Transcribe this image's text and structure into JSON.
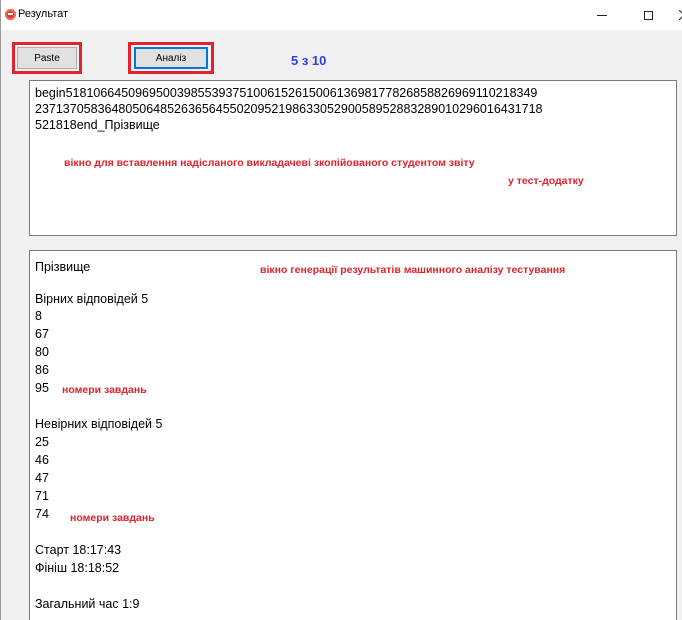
{
  "window": {
    "title": "Результат",
    "accent": "#e0232c",
    "score_color": "#2b3fe0"
  },
  "toolbar": {
    "paste_label": "Paste",
    "analyze_label": "Аналіз",
    "score": "5 з 10"
  },
  "input_panel": {
    "text_lines": [
      "begin5181066450969500398553937510061526150061369817782685882696911021834​9",
      "23713705836480506485263656455020952198633052900589528832890102960164317​18",
      "521818end_Прізвище"
    ],
    "note_line1": "вікно для вставлення надісланого викладачеві зкопійованого студентом звіту",
    "note_line2": "у тест-додатку"
  },
  "result_panel": {
    "surname": "Прізвище",
    "note": "вікно генерації результатів машинного аналізу тестування",
    "correct_header": "Вірних відповідей 5",
    "correct_numbers": [
      "8",
      "67",
      "80",
      "86",
      "95"
    ],
    "correct_note": "номери завдань",
    "wrong_header": "Невірних відповідей 5",
    "wrong_numbers": [
      "25",
      "46",
      "47",
      "71",
      "74"
    ],
    "wrong_note": "номери завдань",
    "start": "Старт 18:17:43",
    "finish": "Фініш 18:18:52",
    "total": "Загальний час 1:9"
  }
}
